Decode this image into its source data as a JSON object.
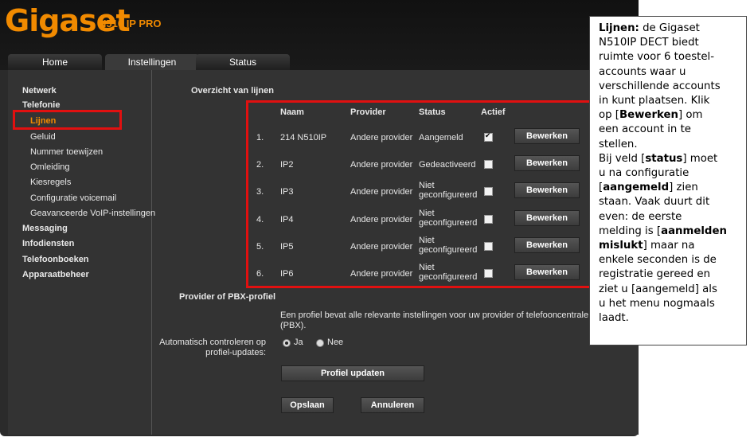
{
  "brand": {
    "logo": "Gigaset",
    "model": "N510 IP PRO"
  },
  "tabs": [
    {
      "label": "Home",
      "active": false
    },
    {
      "label": "Instellingen",
      "active": true
    },
    {
      "label": "Status",
      "active": false
    }
  ],
  "sidebar": {
    "items": [
      {
        "label": "Netwerk",
        "level": 0
      },
      {
        "label": "Telefonie",
        "level": 0
      },
      {
        "label": "Lijnen",
        "level": 1,
        "active": true
      },
      {
        "label": "Geluid",
        "level": 1
      },
      {
        "label": "Nummer toewijzen",
        "level": 1
      },
      {
        "label": "Omleiding",
        "level": 1
      },
      {
        "label": "Kiesregels",
        "level": 1
      },
      {
        "label": "Configuratie voicemail",
        "level": 1
      },
      {
        "label": "Geavanceerde VoIP-instellingen",
        "level": 1
      },
      {
        "label": "Messaging",
        "level": 0
      },
      {
        "label": "Infodiensten",
        "level": 0
      },
      {
        "label": "Telefoonboeken",
        "level": 0
      },
      {
        "label": "Apparaatbeheer",
        "level": 0
      }
    ]
  },
  "lines": {
    "section_title": "Overzicht van lijnen",
    "headers": {
      "name": "Naam",
      "provider": "Provider",
      "status": "Status",
      "active": "Actief"
    },
    "edit_label": "Bewerken",
    "rows": [
      {
        "num": "1.",
        "name": "214 N510IP",
        "provider": "Andere provider",
        "status": "Aangemeld",
        "status2": "",
        "active": true
      },
      {
        "num": "2.",
        "name": "IP2",
        "provider": "Andere provider",
        "status": "Gedeactiveerd",
        "status2": "",
        "active": false
      },
      {
        "num": "3.",
        "name": "IP3",
        "provider": "Andere provider",
        "status": "Niet",
        "status2": "geconfigureerd",
        "active": false
      },
      {
        "num": "4.",
        "name": "IP4",
        "provider": "Andere provider",
        "status": "Niet",
        "status2": "geconfigureerd",
        "active": false
      },
      {
        "num": "5.",
        "name": "IP5",
        "provider": "Andere provider",
        "status": "Niet",
        "status2": "geconfigureerd",
        "active": false
      },
      {
        "num": "6.",
        "name": "IP6",
        "provider": "Andere provider",
        "status": "Niet",
        "status2": "geconfigureerd",
        "active": false
      }
    ]
  },
  "pbx": {
    "title": "Provider of PBX-profiel",
    "description_1": "Een profiel bevat alle relevante instellingen voor uw provider of telefooncentrale",
    "description_2": "(PBX).",
    "auto_check_label_1": "Automatisch controleren op",
    "auto_check_label_2": "profiel-updates:",
    "option_yes": "Ja",
    "option_no": "Nee",
    "selected": "Ja",
    "update_button": "Profiel updaten"
  },
  "footer": {
    "save": "Opslaan",
    "cancel": "Annuleren"
  },
  "note": {
    "l1_bold": "Lijnen:",
    "l1_rest": " de Gigaset",
    "l2": "N510IP DECT biedt",
    "l3": "ruimte voor 6 toestel-",
    "l4": "accounts waar u",
    "l5": "verschillende accounts",
    "l6": "in kunt plaatsen. Klik",
    "l7_a": "op [",
    "l7_b": "Bewerken",
    "l7_c": "] om",
    "l8": "een account in te",
    "l9": "stellen.",
    "l10_a": "Bij veld [",
    "l10_b": "status",
    "l10_c": "] moet",
    "l11": "u na configuratie",
    "l12_a": "[",
    "l12_b": "aangemeld",
    "l12_c": "] zien",
    "l13": "staan. Vaak duurt dit",
    "l14": "even: de eerste",
    "l15_a": "melding is [",
    "l15_b": "aanmelden",
    "l16_b": "mislukt",
    "l16_c": "] maar na",
    "l17": "enkele seconden is de",
    "l18": "registratie gereed en",
    "l19": "ziet u [aangemeld] als",
    "l20": "u het menu nogmaals",
    "l21": "laadt."
  },
  "colors": {
    "brand_orange": "#f18a00",
    "highlight_red": "#e11010",
    "panel": "#333333"
  }
}
